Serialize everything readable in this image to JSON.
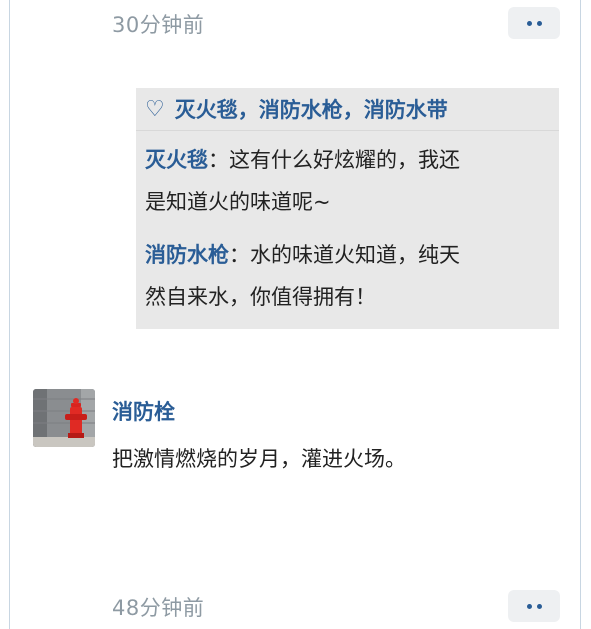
{
  "top_comment": {
    "time": "30分钟前"
  },
  "likes": {
    "icon": "heart-outline-icon",
    "names": "灭火毯，消防水枪，消防水带"
  },
  "replies": [
    {
      "author": "灭火毯",
      "separator": "：",
      "text_line1": "这有什么好炫耀的，我还",
      "text_line2": "是知道火的味道呢~"
    },
    {
      "author": "消防水枪",
      "separator": "：",
      "text_line1": "水的味道火知道，纯天",
      "text_line2": "然自来水，你值得拥有！"
    }
  ],
  "comment": {
    "avatar_icon": "fire-hydrant-avatar",
    "name": "消防栓",
    "text": "把激情燃烧的岁月，灌进火场。",
    "time": "48分钟前"
  },
  "colors": {
    "accent": "#2a5d96",
    "timestamp": "#8e9aa3",
    "reply_bg": "#e8e8e8",
    "button_bg": "#eef0f2"
  }
}
